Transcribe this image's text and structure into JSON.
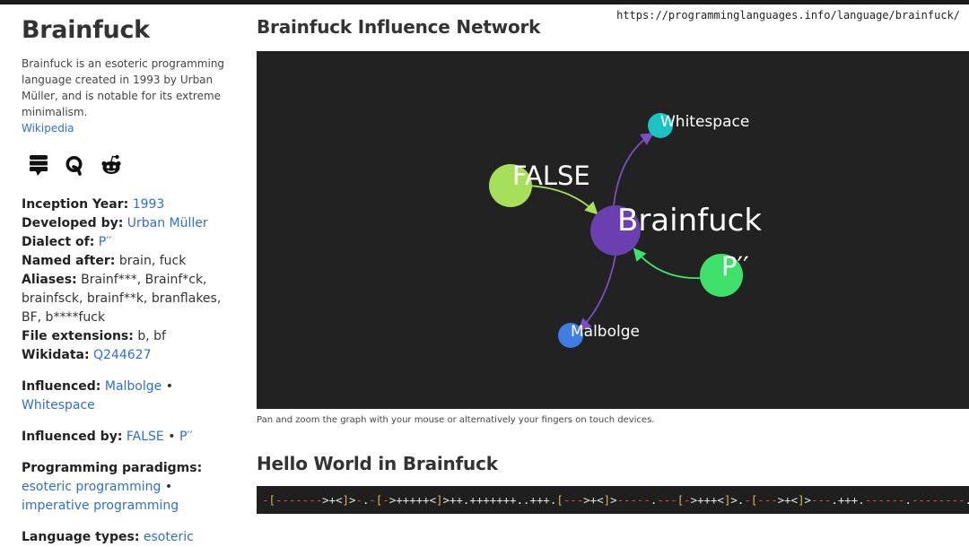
{
  "browser": {
    "url": "https://programminglanguages.info/language/brainfuck/"
  },
  "sidebar": {
    "title": "Brainfuck",
    "description": "Brainfuck is an esoteric programming language created in 1993 by Urban Müller, and is notable for its extreme minimalism.",
    "wiki_link": "Wikipedia",
    "icons": [
      "stack-exchange-icon",
      "quora-icon",
      "reddit-icon"
    ],
    "facts": [
      {
        "label": "Inception Year:",
        "value": "1993",
        "link": true
      },
      {
        "label": "Developed by:",
        "value": "Urban Müller",
        "link": true
      },
      {
        "label": "Dialect of:",
        "value": "P′′",
        "link": true
      },
      {
        "label": "Named after:",
        "value": "brain, fuck",
        "link": false
      },
      {
        "label": "Aliases:",
        "value": "Brainf***, Brainf*ck, brainfsck, brainf**k, branflakes, BF, b****fuck",
        "link": false
      },
      {
        "label": "File extensions:",
        "value": "b, bf",
        "link": false
      },
      {
        "label": "Wikidata:",
        "value": "Q244627",
        "link": true
      }
    ],
    "influenced": {
      "label": "Influenced:",
      "items": [
        "Malbolge",
        "Whitespace"
      ]
    },
    "influenced_by": {
      "label": "Influenced by:",
      "items": [
        "FALSE",
        "P′′"
      ]
    },
    "paradigms": {
      "label": "Programming paradigms:",
      "items": [
        "esoteric programming",
        "imperative programming"
      ]
    },
    "types": {
      "label": "Language types:",
      "items": [
        "esoteric"
      ]
    }
  },
  "main": {
    "network_title": "Brainfuck Influence Network",
    "graph": {
      "center": {
        "label": "Brainfuck",
        "color": "#6a3fb0"
      },
      "nodes": [
        {
          "label": "FALSE",
          "color": "#a6e05a"
        },
        {
          "label": "Whitespace",
          "color": "#1cc3c3"
        },
        {
          "label": "P′′",
          "color": "#3ee26a"
        },
        {
          "label": "Malbolge",
          "color": "#3f7de0"
        }
      ]
    },
    "caption": "Pan and zoom the graph with your mouse or alternatively your fingers on touch devices.",
    "hello_title": "Hello World in Brainfuck",
    "code": "-[------->+<]>-.-[->+++++<]>++.+++++++..+++.[--->+<]>-----.---[->+++<]>.-[--->+<]>---.+++.------.--------."
  }
}
